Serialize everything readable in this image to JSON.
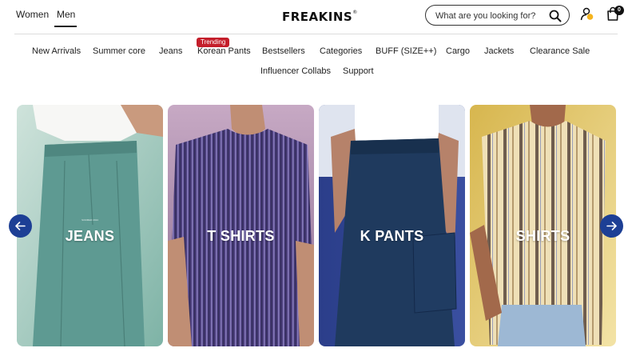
{
  "header": {
    "gender_tabs": [
      "Women",
      "Men"
    ],
    "active_tab": "Men",
    "logo": "FREAKINS",
    "logo_mark": "®",
    "search_placeholder": "What are you looking for?",
    "cart_count": "0"
  },
  "nav": {
    "items": [
      "New Arrivals",
      "Summer core",
      "Jeans",
      "Korean Pants",
      "Bestsellers",
      "Categories",
      "BUFF (SIZE++)",
      "Cargo",
      "Jackets",
      "Clearance Sale",
      "Influencer Collabs",
      "Support"
    ],
    "trending_badge": "Trending"
  },
  "carousel": {
    "cards": [
      {
        "label": "JEANS"
      },
      {
        "label": "T SHIRTS"
      },
      {
        "label": "K PANTS"
      },
      {
        "label": "SHIRTS"
      }
    ]
  },
  "colors": {
    "arrow": "#1d3f95",
    "badge": "#c41e2b"
  }
}
